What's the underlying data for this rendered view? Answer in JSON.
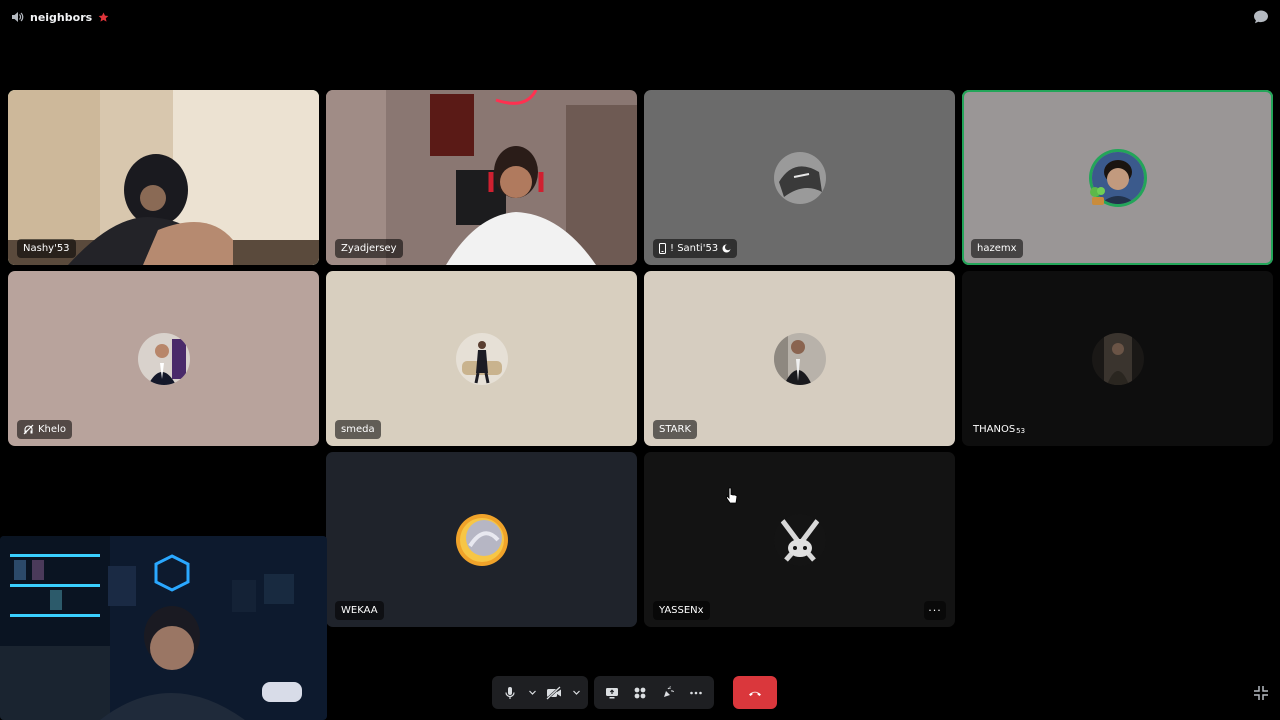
{
  "header": {
    "channel_name": "neighbors",
    "channel_icon": "speaker-icon",
    "badge_icon": "red-star-icon",
    "chat_icon": "chat-bubble-icon"
  },
  "colors": {
    "background": "#000000",
    "speaking": "#23a559",
    "hangup": "#da373c",
    "control_bg": "#1e1f22"
  },
  "participants": [
    {
      "name": "Nashy'53",
      "kind": "video",
      "speaking": true
    },
    {
      "name": "Zyadjersey",
      "kind": "video",
      "speaking": false
    },
    {
      "name": "! Santi'53",
      "kind": "avatar",
      "prefix_icon": "mobile-phone-icon",
      "suffix_icon": "moon-icon"
    },
    {
      "name": "hazemx",
      "kind": "avatar",
      "speaking": true
    },
    {
      "name": "Khelo",
      "kind": "avatar",
      "prefix_icon": "deafened-icon"
    },
    {
      "name": "smeda",
      "kind": "avatar"
    },
    {
      "name": "STARK",
      "kind": "avatar"
    },
    {
      "name": "THANOS",
      "name_suffix": "53",
      "kind": "avatar"
    },
    {
      "name": "WEKAA",
      "kind": "avatar"
    },
    {
      "name": "YASSENx",
      "kind": "avatar",
      "more_label": "···"
    }
  ],
  "self_view": {
    "kind": "video"
  },
  "controls": {
    "mic": "microphone-icon",
    "mic_options": "chevron-down-icon",
    "camera": "camera-off-icon",
    "camera_options": "chevron-down-icon",
    "screen_share": "screen-share-icon",
    "activities": "activities-icon",
    "soundboard": "soundboard-icon",
    "more": "more-icon",
    "disconnect": "phone-hangup-icon"
  },
  "fullscreen_icon": "exit-fullscreen-icon"
}
